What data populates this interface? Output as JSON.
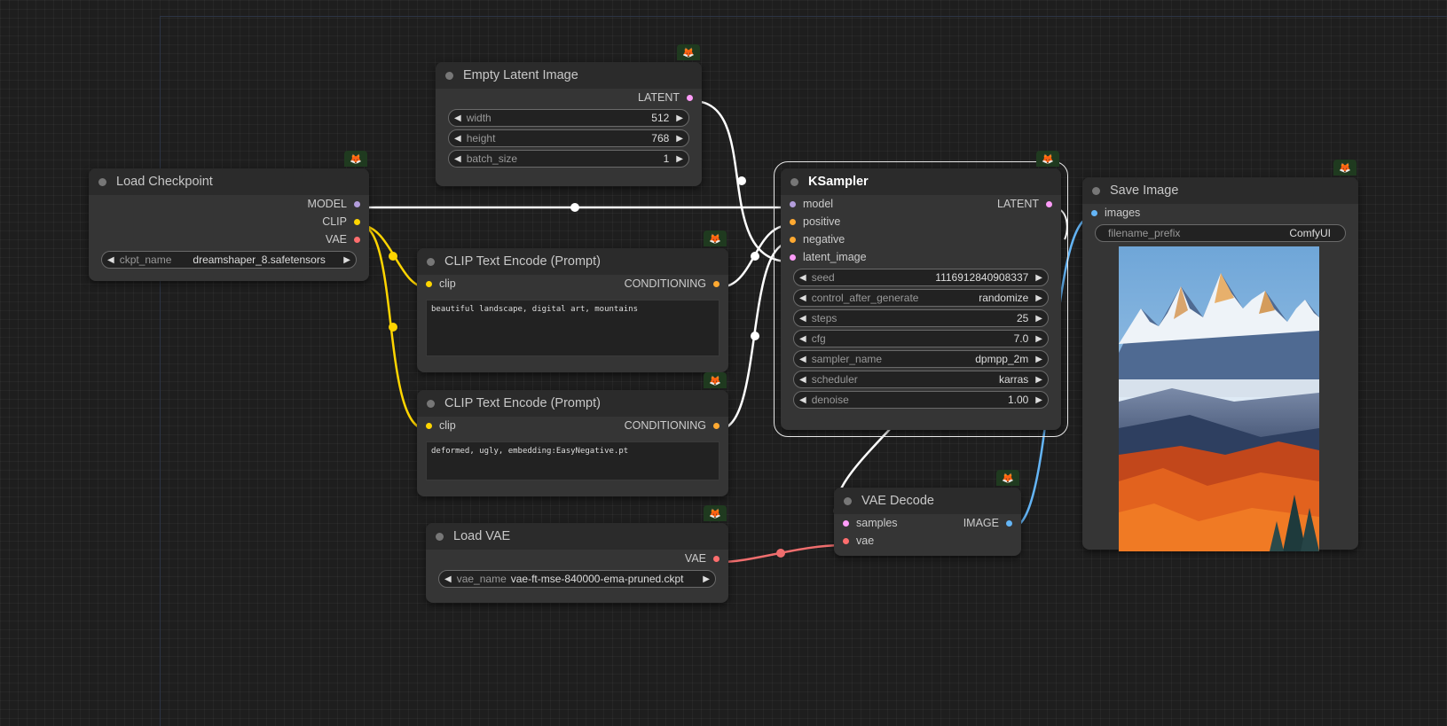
{
  "nodes": {
    "empty_latent": {
      "title": "Empty Latent Image",
      "output": "LATENT",
      "widgets": [
        {
          "label": "width",
          "value": "512"
        },
        {
          "label": "height",
          "value": "768"
        },
        {
          "label": "batch_size",
          "value": "1"
        }
      ]
    },
    "load_checkpoint": {
      "title": "Load Checkpoint",
      "outputs": [
        "MODEL",
        "CLIP",
        "VAE"
      ],
      "widget": {
        "label": "ckpt_name",
        "value": "dreamshaper_8.safetensors"
      }
    },
    "clip_pos": {
      "title": "CLIP Text Encode (Prompt)",
      "input": "clip",
      "output": "CONDITIONING",
      "text": "beautiful landscape, digital art, mountains"
    },
    "clip_neg": {
      "title": "CLIP Text Encode (Prompt)",
      "input": "clip",
      "output": "CONDITIONING",
      "text": "deformed, ugly, embedding:EasyNegative.pt"
    },
    "load_vae": {
      "title": "Load VAE",
      "output": "VAE",
      "widget": {
        "label": "vae_name",
        "value": "vae-ft-mse-840000-ema-pruned.ckpt"
      }
    },
    "ksampler": {
      "title": "KSampler",
      "inputs": [
        "model",
        "positive",
        "negative",
        "latent_image"
      ],
      "output": "LATENT",
      "widgets": [
        {
          "label": "seed",
          "value": "1116912840908337"
        },
        {
          "label": "control_after_generate",
          "value": "randomize"
        },
        {
          "label": "steps",
          "value": "25"
        },
        {
          "label": "cfg",
          "value": "7.0"
        },
        {
          "label": "sampler_name",
          "value": "dpmpp_2m"
        },
        {
          "label": "scheduler",
          "value": "karras"
        },
        {
          "label": "denoise",
          "value": "1.00"
        }
      ]
    },
    "vae_decode": {
      "title": "VAE Decode",
      "inputs": [
        "samples",
        "vae"
      ],
      "output": "IMAGE"
    },
    "save_image": {
      "title": "Save Image",
      "input": "images",
      "widget": {
        "label": "filename_prefix",
        "value": "ComfyUI"
      }
    }
  },
  "colors": {
    "model": "#b39ddb",
    "clip": "#ffd500",
    "vae": "#ff6e6e",
    "latent": "#ff9cf9",
    "conditioning": "#ffa931",
    "image": "#64b5f6",
    "link_default": "#ffffff"
  },
  "icons": {
    "node_badge": "fox-icon",
    "widget_decrement": "triangle-left-icon",
    "widget_increment": "triangle-right-icon"
  },
  "glyphs": {
    "left": "◀",
    "right": "▶",
    "badge": "🦊"
  }
}
